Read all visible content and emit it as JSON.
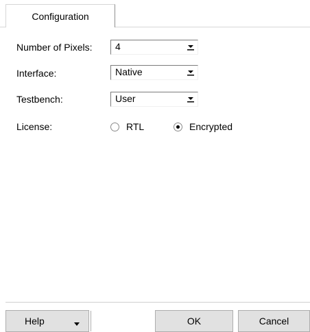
{
  "tabs": [
    {
      "label": "Configuration",
      "active": true
    }
  ],
  "form": {
    "pixels": {
      "label": "Number of Pixels:",
      "value": "4"
    },
    "interface": {
      "label": "Interface:",
      "value": "Native"
    },
    "testbench": {
      "label": "Testbench:",
      "value": "User"
    },
    "license": {
      "label": "License:",
      "options": [
        {
          "label": "RTL",
          "selected": false
        },
        {
          "label": "Encrypted",
          "selected": true
        }
      ]
    }
  },
  "buttons": {
    "help": "Help",
    "ok": "OK",
    "cancel": "Cancel"
  },
  "icons": {
    "dropdown": "chevron-down-icon",
    "help_menu": "caret-down-icon"
  },
  "colors": {
    "background": "#ffffff",
    "button_face": "#e1e1e1",
    "button_border": "#adadad",
    "divider": "#cfcfcf"
  }
}
